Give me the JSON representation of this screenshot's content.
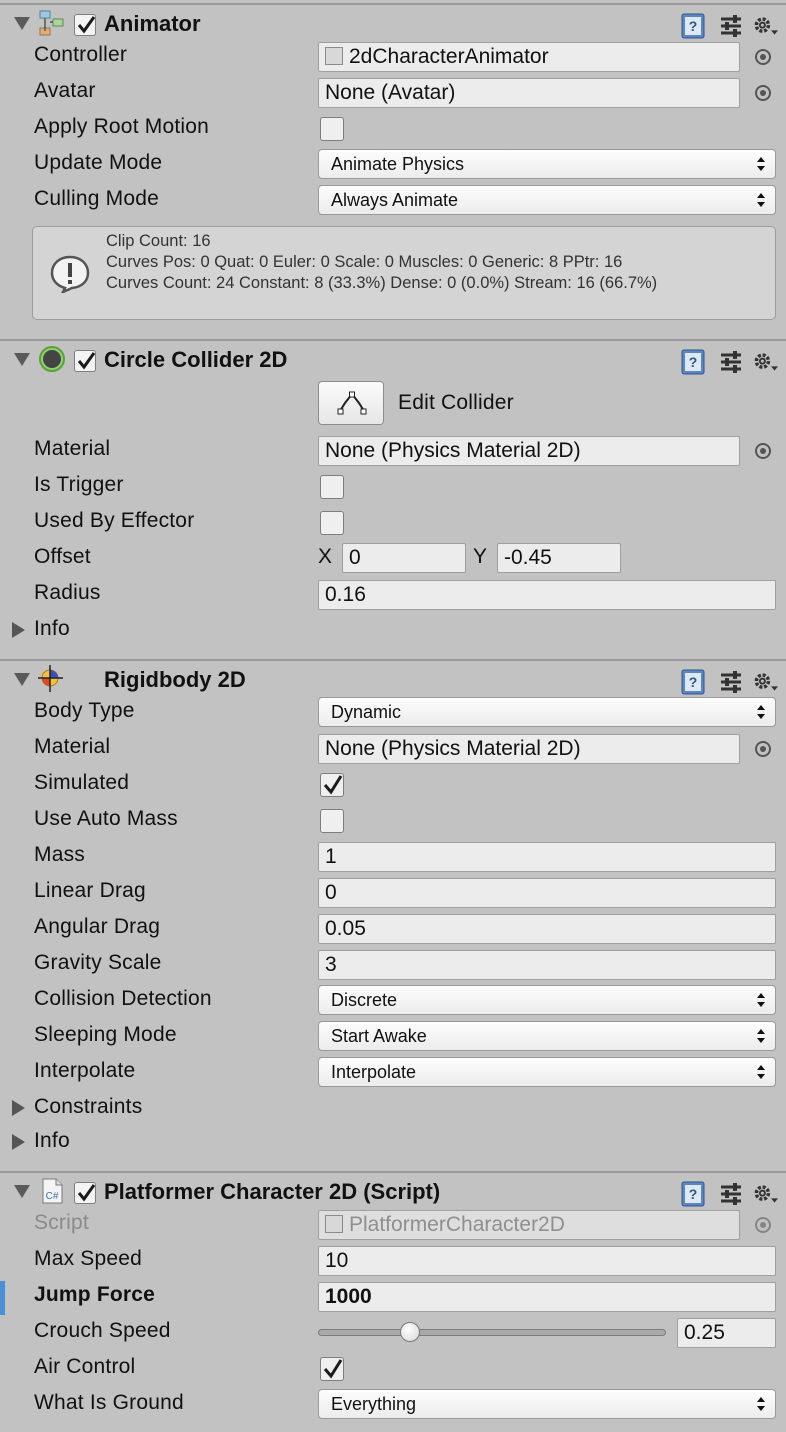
{
  "animator": {
    "title": "Animator",
    "controller": {
      "label": "Controller",
      "value": "2dCharacterAnimator"
    },
    "avatar": {
      "label": "Avatar",
      "value": "None (Avatar)"
    },
    "apply_root_motion": {
      "label": "Apply Root Motion",
      "checked": false
    },
    "update_mode": {
      "label": "Update Mode",
      "value": "Animate Physics"
    },
    "culling_mode": {
      "label": "Culling Mode",
      "value": "Always Animate"
    },
    "info": {
      "line1": "Clip Count: 16",
      "line2": "Curves Pos: 0 Quat: 0 Euler: 0 Scale: 0 Muscles: 0 Generic: 8 PPtr: 16",
      "line3": "Curves Count: 24 Constant: 8 (33.3%) Dense: 0 (0.0%) Stream: 16 (66.7%)"
    }
  },
  "circle_collider": {
    "title": "Circle Collider 2D",
    "edit_collider": "Edit Collider",
    "material": {
      "label": "Material",
      "value": "None (Physics Material 2D)"
    },
    "is_trigger": {
      "label": "Is Trigger",
      "checked": false
    },
    "used_by_effector": {
      "label": "Used By Effector",
      "checked": false
    },
    "offset": {
      "label": "Offset",
      "x_label": "X",
      "x": "0",
      "y_label": "Y",
      "y": "-0.45"
    },
    "radius": {
      "label": "Radius",
      "value": "0.16"
    },
    "info": "Info"
  },
  "rigidbody": {
    "title": "Rigidbody 2D",
    "body_type": {
      "label": "Body Type",
      "value": "Dynamic"
    },
    "material": {
      "label": "Material",
      "value": "None (Physics Material 2D)"
    },
    "simulated": {
      "label": "Simulated",
      "checked": true
    },
    "use_auto_mass": {
      "label": "Use Auto Mass",
      "checked": false
    },
    "mass": {
      "label": "Mass",
      "value": "1"
    },
    "linear_drag": {
      "label": "Linear Drag",
      "value": "0"
    },
    "angular_drag": {
      "label": "Angular Drag",
      "value": "0.05"
    },
    "gravity_scale": {
      "label": "Gravity Scale",
      "value": "3"
    },
    "collision_detection": {
      "label": "Collision Detection",
      "value": "Discrete"
    },
    "sleeping_mode": {
      "label": "Sleeping Mode",
      "value": "Start Awake"
    },
    "interpolate": {
      "label": "Interpolate",
      "value": "Interpolate"
    },
    "constraints": "Constraints",
    "info": "Info"
  },
  "script": {
    "title": "Platformer Character 2D (Script)",
    "icon_text": "C#",
    "script": {
      "label": "Script",
      "value": "PlatformerCharacter2D"
    },
    "max_speed": {
      "label": "Max Speed",
      "value": "10"
    },
    "jump_force": {
      "label": "Jump Force",
      "value": "1000"
    },
    "crouch_speed": {
      "label": "Crouch Speed",
      "value": "0.25",
      "slider_fraction": 0.25
    },
    "air_control": {
      "label": "Air Control",
      "checked": true
    },
    "what_is_ground": {
      "label": "What Is Ground",
      "value": "Everything"
    }
  },
  "colors": {
    "background": "#c2c2c2",
    "checkmark": "#1a1a1a",
    "field_bg": "#ececec",
    "modified_marker": "#4a90d9"
  },
  "icons": [
    "animator-icon",
    "circle-collider-icon",
    "rigidbody-icon",
    "csharp-script-icon",
    "help-icon",
    "preset-icon",
    "gear-icon",
    "object-picker-icon",
    "info-icon",
    "edit-collider-icon"
  ]
}
